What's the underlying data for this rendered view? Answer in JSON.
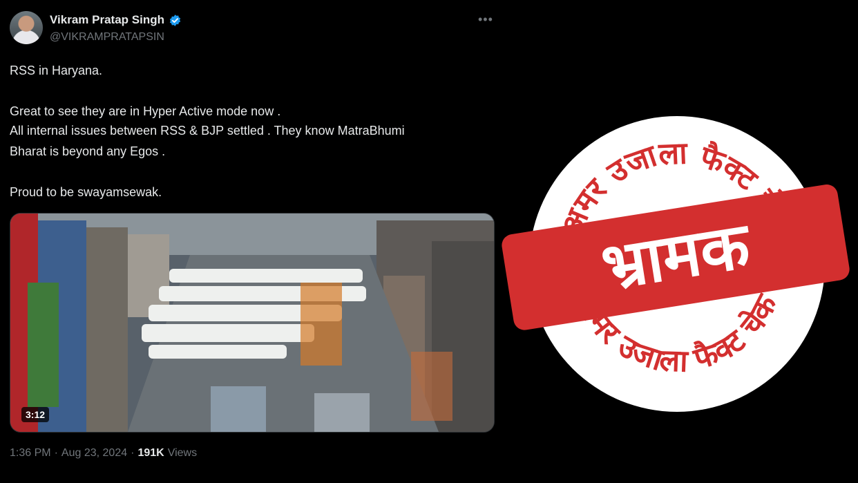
{
  "tweet": {
    "author_name": "Vikram Pratap Singh",
    "handle": "@VIKRAMPRATAPSIN",
    "lines": [
      "RSS in Haryana.",
      "Great to see they are in Hyper Active mode now .",
      "All internal issues between RSS & BJP settled . They know MatraBhumi",
      "Bharat is beyond any Egos .",
      "Proud to be swayamsewak."
    ],
    "video_duration": "3:12",
    "time": "1:36 PM",
    "separator": "·",
    "date": "Aug 23, 2024",
    "views_count": "191K",
    "views_label": "Views",
    "more_icon": "more-dots-icon",
    "verified_icon": "verified-badge-icon"
  },
  "stamp": {
    "top_text": "अमर उजाला फैक्ट चेक",
    "bottom_text": "अमर उजाला फैक्ट चेक",
    "verdict": "भ्रामक",
    "color": "#d32f2f"
  }
}
